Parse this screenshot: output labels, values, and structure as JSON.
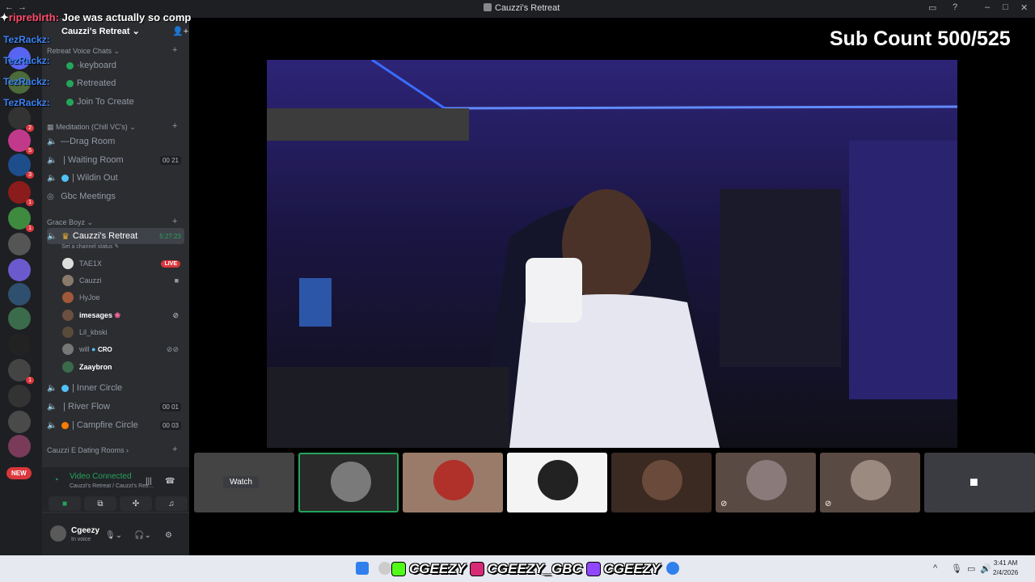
{
  "window": {
    "title": "Cauzzi's Retreat"
  },
  "overlay": {
    "chat_name": "ripreblrth:",
    "chat_text": "Joe was actually so comp",
    "tez_names": [
      "TezRackz:",
      "TezRackz:",
      "TezRackz:",
      "TezRackz:"
    ]
  },
  "server": {
    "name": "Cauzzi's Retreat",
    "categories": {
      "retreat_voice": "Retreat Voice Chats",
      "meditation": "Meditation (Chill VC's)",
      "grace_boyz": "Grace Boyz",
      "dating": "Cauzzi E Dating Rooms"
    },
    "channels": {
      "keyboard": "keyboard",
      "retreated": "Retreated",
      "join_to_create": "Join To Create",
      "drag_room": "Drag Room",
      "waiting_room": "| Waiting Room",
      "waiting_room_count_a": "00",
      "waiting_room_count_b": "21",
      "wildin_out": "| Wildin Out",
      "gbc_meetings": "Gbc Meetings",
      "cauzzis_retreat": "Cauzzi's Retreat",
      "cauzzis_retreat_time": "5:27:23",
      "status_placeholder": "Set a channel status",
      "inner_circle": "| Inner Circle",
      "river_flow": "| River Flow",
      "river_flow_count_a": "00",
      "river_flow_count_b": "01",
      "campfire_circle": "| Campfire Circle",
      "campfire_count_a": "00",
      "campfire_count_b": "03"
    },
    "voice_users": [
      {
        "name": "TAE1X",
        "badge": "LIVE"
      },
      {
        "name": "Cauzzi",
        "badge": ""
      },
      {
        "name": "HyJoe",
        "badge": ""
      },
      {
        "name": "imesages",
        "badge": ""
      },
      {
        "name": "Lil_kbski",
        "badge": ""
      },
      {
        "name": "will",
        "badge": "CRO"
      },
      {
        "name": "Zaaybron",
        "badge": ""
      }
    ]
  },
  "server_list": {
    "new_label": "NEW",
    "badges": [
      "2",
      "5",
      "3",
      "1",
      "1",
      "1"
    ]
  },
  "voice_panel": {
    "title": "Video Connected",
    "subtitle": "Cauzzi's Retreat / Cauzzi's Retr..."
  },
  "user_panel": {
    "username": "Cgeezy",
    "status": "In voice"
  },
  "stage": {
    "sub_count": "Sub Count 500/525",
    "watch_label": "Watch"
  },
  "taskbar": {
    "socials": [
      "CGEEZY",
      "CGEEZY_GBC",
      "CGEEZY"
    ],
    "time": "3:41 AM",
    "date": "2/4/2026"
  },
  "colors": {
    "accent_green": "#23a55a",
    "live_red": "#da373c",
    "sidebar_bg": "#2b2d31",
    "server_bg": "#1e1f22"
  }
}
